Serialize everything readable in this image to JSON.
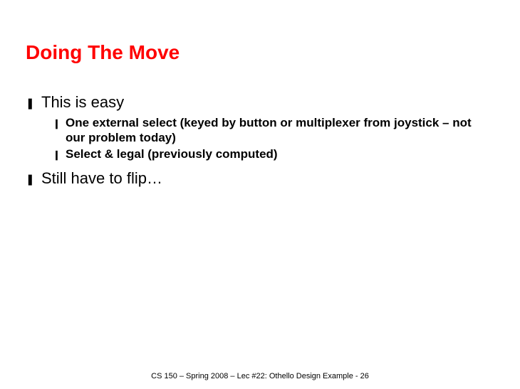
{
  "title": "Doing The Move",
  "bullets": {
    "b1": "This is easy",
    "b1_1": "One external select (keyed by button or multiplexer from joystick – not our problem today)",
    "b1_2": "Select & legal (previously computed)",
    "b2": "Still have to flip…"
  },
  "glyphs": {
    "lvl1": "❚",
    "lvl2": "❙"
  },
  "footer": "CS 150 – Spring  2008 – Lec #22: Othello Design Example - 26"
}
